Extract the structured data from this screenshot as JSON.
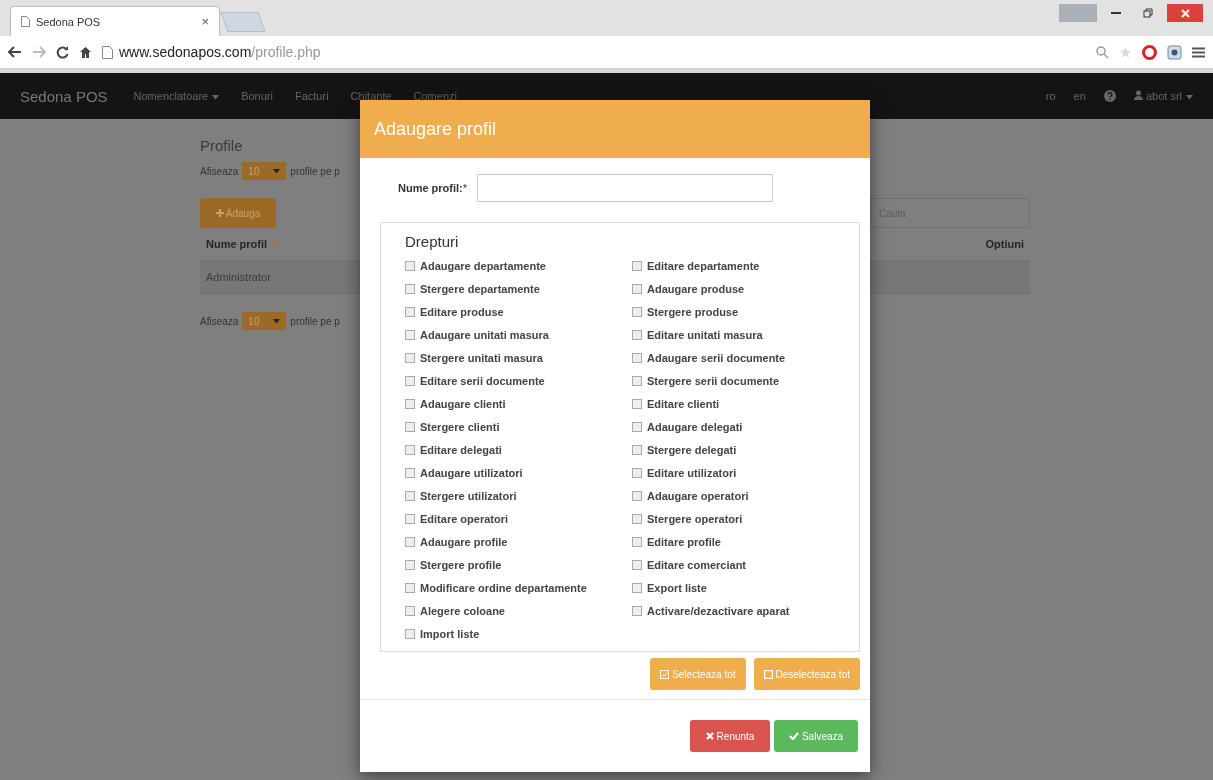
{
  "browser": {
    "tab_title": "Sedona POS",
    "tab_close": "×",
    "url_host": "www.sedonapos.com",
    "url_path": "/profile.php"
  },
  "navbar": {
    "brand": "Sedona POS",
    "items": [
      {
        "label": "Nomenclatoare",
        "dropdown": true
      },
      {
        "label": "Bonuri",
        "dropdown": false
      },
      {
        "label": "Facturi",
        "dropdown": false
      },
      {
        "label": "Chitante",
        "dropdown": false
      },
      {
        "label": "Comenzi",
        "dropdown": false
      }
    ],
    "languages": [
      "ro",
      "en"
    ],
    "user": "abot srl"
  },
  "page": {
    "title": "Profile",
    "show_prefix": "Afiseaza",
    "page_size": "10",
    "show_suffix": "profile pe p",
    "add_button": "Adauga",
    "search": {
      "placeholder": "Cauta"
    },
    "columns": [
      "Nume profil",
      "Optiuni"
    ],
    "rows": [
      "Administrator"
    ],
    "bottom_prefix": "Afiseaza",
    "bottom_page_size": "10",
    "bottom_suffix": "profile pe p"
  },
  "modal": {
    "title": "Adaugare profil",
    "name_label": "Nume profil:",
    "name_required": "*",
    "rights_title": "Drepturi",
    "rights": [
      {
        "label": "Adaugare departamente",
        "checked": false
      },
      {
        "label": "Editare departamente",
        "checked": false
      },
      {
        "label": "Stergere departamente",
        "checked": false
      },
      {
        "label": "Adaugare produse",
        "checked": false
      },
      {
        "label": "Editare produse",
        "checked": false
      },
      {
        "label": "Stergere produse",
        "checked": false
      },
      {
        "label": "Adaugare unitati masura",
        "checked": false
      },
      {
        "label": "Editare unitati masura",
        "checked": false
      },
      {
        "label": "Stergere unitati masura",
        "checked": false
      },
      {
        "label": "Adaugare serii documente",
        "checked": false
      },
      {
        "label": "Editare serii documente",
        "checked": false
      },
      {
        "label": "Stergere serii documente",
        "checked": false
      },
      {
        "label": "Adaugare clienti",
        "checked": false
      },
      {
        "label": "Editare clienti",
        "checked": false
      },
      {
        "label": "Stergere clienti",
        "checked": false
      },
      {
        "label": "Adaugare delegati",
        "checked": false
      },
      {
        "label": "Editare delegati",
        "checked": false
      },
      {
        "label": "Stergere delegati",
        "checked": false
      },
      {
        "label": "Adaugare utilizatori",
        "checked": false
      },
      {
        "label": "Editare utilizatori",
        "checked": false
      },
      {
        "label": "Stergere utilizatori",
        "checked": false
      },
      {
        "label": "Adaugare operatori",
        "checked": false
      },
      {
        "label": "Editare operatori",
        "checked": false
      },
      {
        "label": "Stergere operatori",
        "checked": false
      },
      {
        "label": "Adaugare profile",
        "checked": false
      },
      {
        "label": "Editare profile",
        "checked": false
      },
      {
        "label": "Stergere profile",
        "checked": false
      },
      {
        "label": "Editare comerciant",
        "checked": false
      },
      {
        "label": "Modificare ordine departamente",
        "checked": false
      },
      {
        "label": "Export liste",
        "checked": false
      },
      {
        "label": "Alegere coloane",
        "checked": false
      },
      {
        "label": "Activare/dezactivare aparat",
        "checked": false
      },
      {
        "label": "Import liste",
        "checked": false
      }
    ],
    "select_all": "Selecteaza tot",
    "deselect_all": "Deselecteaza tot",
    "cancel": "Renunta",
    "save": "Salveaza"
  }
}
